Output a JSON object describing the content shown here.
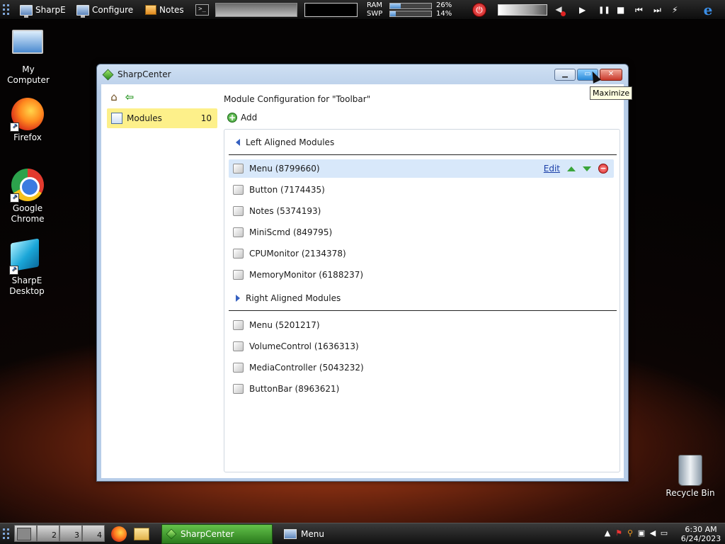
{
  "topbar": {
    "buttons": [
      {
        "label": "SharpE",
        "icon": "monitor-icon"
      },
      {
        "label": "Configure",
        "icon": "monitor-icon"
      },
      {
        "label": "Notes",
        "icon": "notes-icon"
      }
    ],
    "terminal_icon_glyph": ">_",
    "ram_label": "RAM",
    "swp_label": "SWP",
    "ram_percent": "26%",
    "swp_percent": "14%",
    "ram_fraction": 0.26,
    "swp_fraction": 0.14,
    "media": {
      "play": "▶",
      "pause": "❚❚",
      "stop": "■",
      "prev": "⏮",
      "next": "⏭"
    }
  },
  "desktop_icons": [
    {
      "label": "My Computer",
      "icon": "computer-icon"
    },
    {
      "label": "Firefox",
      "icon": "firefox-icon"
    },
    {
      "label": "Google Chrome",
      "icon": "chrome-icon"
    },
    {
      "label": "SharpE Desktop",
      "icon": "sharpe-desktop-icon"
    },
    {
      "label": "Recycle Bin",
      "icon": "recycle-bin-icon"
    }
  ],
  "window": {
    "title": "SharpCenter",
    "tooltip": "Maximize",
    "sidebar": {
      "items": [
        {
          "label": "Modules",
          "count": "10"
        }
      ]
    },
    "config_title": "Module Configuration for \"Toolbar\"",
    "add_label": "Add",
    "left_section": {
      "title": "Left Aligned Modules",
      "modules": [
        {
          "label": "Menu (8799660)"
        },
        {
          "label": "Button (7174435)"
        },
        {
          "label": "Notes (5374193)"
        },
        {
          "label": "MiniScmd (849795)"
        },
        {
          "label": "CPUMonitor (2134378)"
        },
        {
          "label": "MemoryMonitor (6188237)"
        }
      ]
    },
    "right_section": {
      "title": "Right Aligned Modules",
      "modules": [
        {
          "label": "Menu (5201217)"
        },
        {
          "label": "VolumeControl (1636313)"
        },
        {
          "label": "MediaController (5043232)"
        },
        {
          "label": "ButtonBar (8963621)"
        }
      ]
    },
    "row_actions": {
      "edit_label": "Edit"
    }
  },
  "taskbar": {
    "desktops": [
      "",
      "2",
      "3",
      "4"
    ],
    "tasks": [
      {
        "label": "SharpCenter",
        "active": true
      },
      {
        "label": "Menu",
        "active": false
      }
    ],
    "clock": {
      "time": "6:30 AM",
      "date": "6/24/2023"
    }
  },
  "colors": {
    "selected_row": "#d8e8fa",
    "sidebar_highlight": "#fdf08a",
    "link": "#1b3fa8",
    "active_task": "#2a7a1c"
  }
}
